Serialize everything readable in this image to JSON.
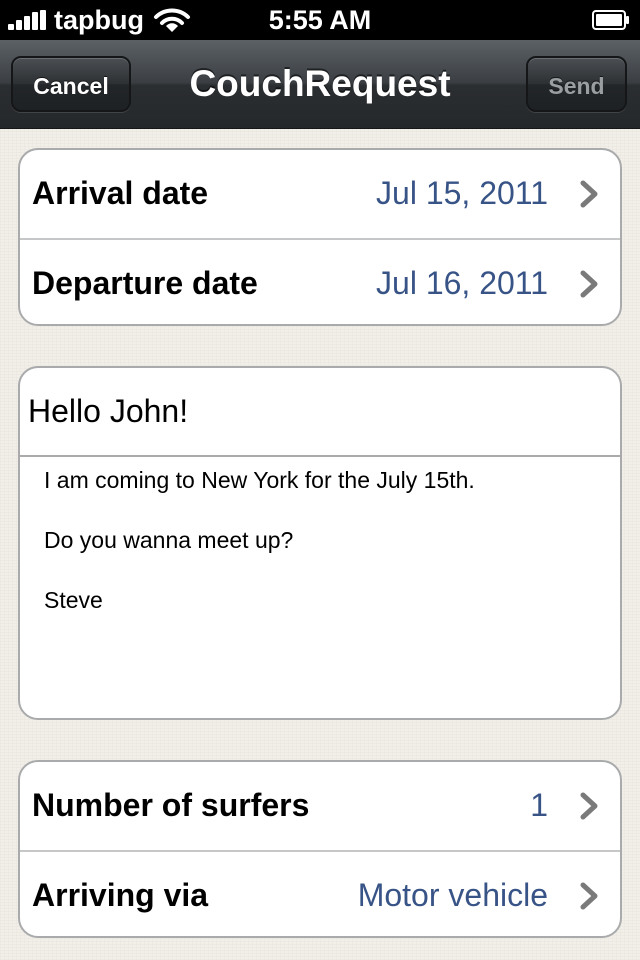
{
  "status_bar": {
    "carrier": "tapbug",
    "time": "5:55 AM",
    "icons": [
      "signal-bars-icon",
      "wifi-icon",
      "battery-icon"
    ]
  },
  "nav_bar": {
    "title": "CouchRequest",
    "cancel_label": "Cancel",
    "send_label": "Send"
  },
  "dates": [
    {
      "label": "Arrival date",
      "value": "Jul 15, 2011"
    },
    {
      "label": "Departure date",
      "value": "Jul 16, 2011"
    }
  ],
  "message": {
    "subject": "Hello John!",
    "lines": [
      "I am coming to New York for the July 15th.",
      "Do you wanna meet up?",
      "Steve"
    ]
  },
  "options": [
    {
      "label": "Number of surfers",
      "value": "1"
    },
    {
      "label": "Arriving via",
      "value": "Motor vehicle"
    }
  ],
  "colors": {
    "value_text": "#385487",
    "background": "#f2efe9",
    "nav_bar": "#2b2e31"
  }
}
